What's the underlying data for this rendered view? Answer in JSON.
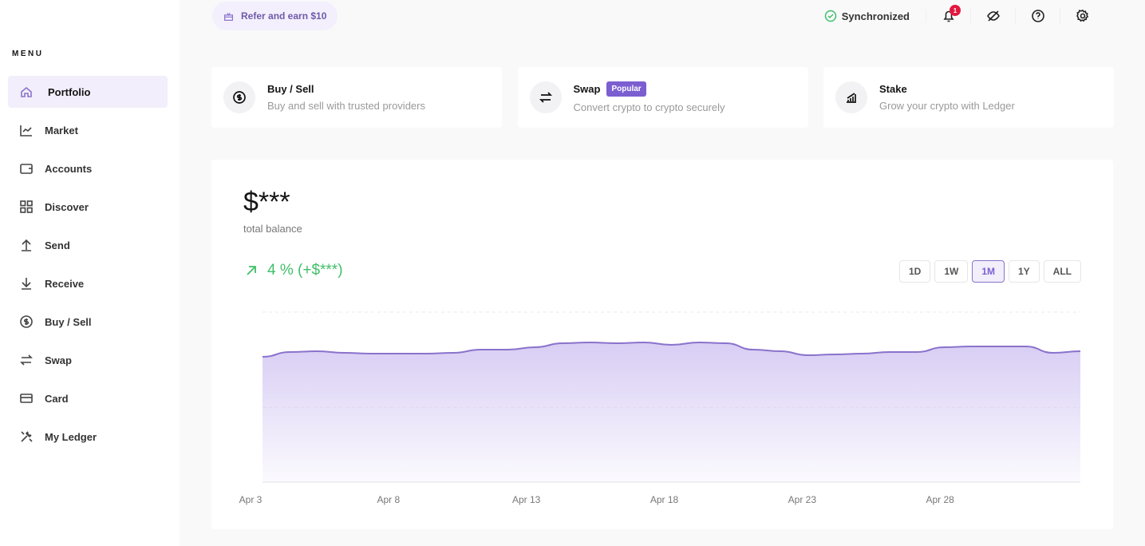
{
  "sidebar": {
    "menu_title": "MENU",
    "items": [
      {
        "label": "Portfolio",
        "icon": "home-icon",
        "active": true
      },
      {
        "label": "Market",
        "icon": "chart-icon"
      },
      {
        "label": "Accounts",
        "icon": "wallet-icon"
      },
      {
        "label": "Discover",
        "icon": "grid-icon"
      },
      {
        "label": "Send",
        "icon": "arrow-up-icon"
      },
      {
        "label": "Receive",
        "icon": "arrow-down-icon"
      },
      {
        "label": "Buy / Sell",
        "icon": "dollar-icon"
      },
      {
        "label": "Swap",
        "icon": "swap-icon"
      },
      {
        "label": "Card",
        "icon": "card-icon"
      },
      {
        "label": "My Ledger",
        "icon": "tools-icon"
      }
    ]
  },
  "header": {
    "refer": "Refer and earn $10",
    "sync": "Synchronized",
    "notifications": "1"
  },
  "cards": [
    {
      "title": "Buy / Sell",
      "subtitle": "Buy and sell with trusted providers",
      "icon": "dollar-icon"
    },
    {
      "title": "Swap",
      "subtitle": "Convert crypto to crypto securely",
      "badge": "Popular",
      "icon": "swap-icon"
    },
    {
      "title": "Stake",
      "subtitle": "Grow your crypto with Ledger",
      "icon": "stake-icon"
    }
  ],
  "balance": {
    "value": "$***",
    "label": "total balance",
    "change": "4 % (+$***)"
  },
  "ranges": [
    "1D",
    "1W",
    "1M",
    "1Y",
    "ALL"
  ],
  "selected_range": "1M",
  "colors": {
    "accent": "#7b5fd1",
    "line": "#8a73cc",
    "positive": "#3fbf68"
  },
  "chart_data": {
    "type": "area",
    "grid": true,
    "x": [
      "Apr 3",
      "Apr 4",
      "Apr 5",
      "Apr 6",
      "Apr 7",
      "Apr 8",
      "Apr 9",
      "Apr 10",
      "Apr 11",
      "Apr 12",
      "Apr 13",
      "Apr 14",
      "Apr 15",
      "Apr 16",
      "Apr 17",
      "Apr 18",
      "Apr 19",
      "Apr 20",
      "Apr 21",
      "Apr 22",
      "Apr 23",
      "Apr 24",
      "Apr 25",
      "Apr 26",
      "Apr 27",
      "Apr 28",
      "Apr 29",
      "Apr 30",
      "May 1",
      "May 2",
      "May 3"
    ],
    "values": [
      53,
      59,
      60,
      58,
      57,
      57,
      57,
      58,
      62,
      62,
      65,
      70,
      71,
      70,
      71,
      68,
      71,
      70,
      62,
      60,
      55,
      56,
      57,
      59,
      59,
      65,
      66,
      66,
      66,
      58,
      60
    ],
    "ylim": [
      -104,
      109
    ],
    "xticks": [
      "Apr 3",
      "Apr 8",
      "Apr 13",
      "Apr 18",
      "Apr 23",
      "Apr 28"
    ]
  }
}
